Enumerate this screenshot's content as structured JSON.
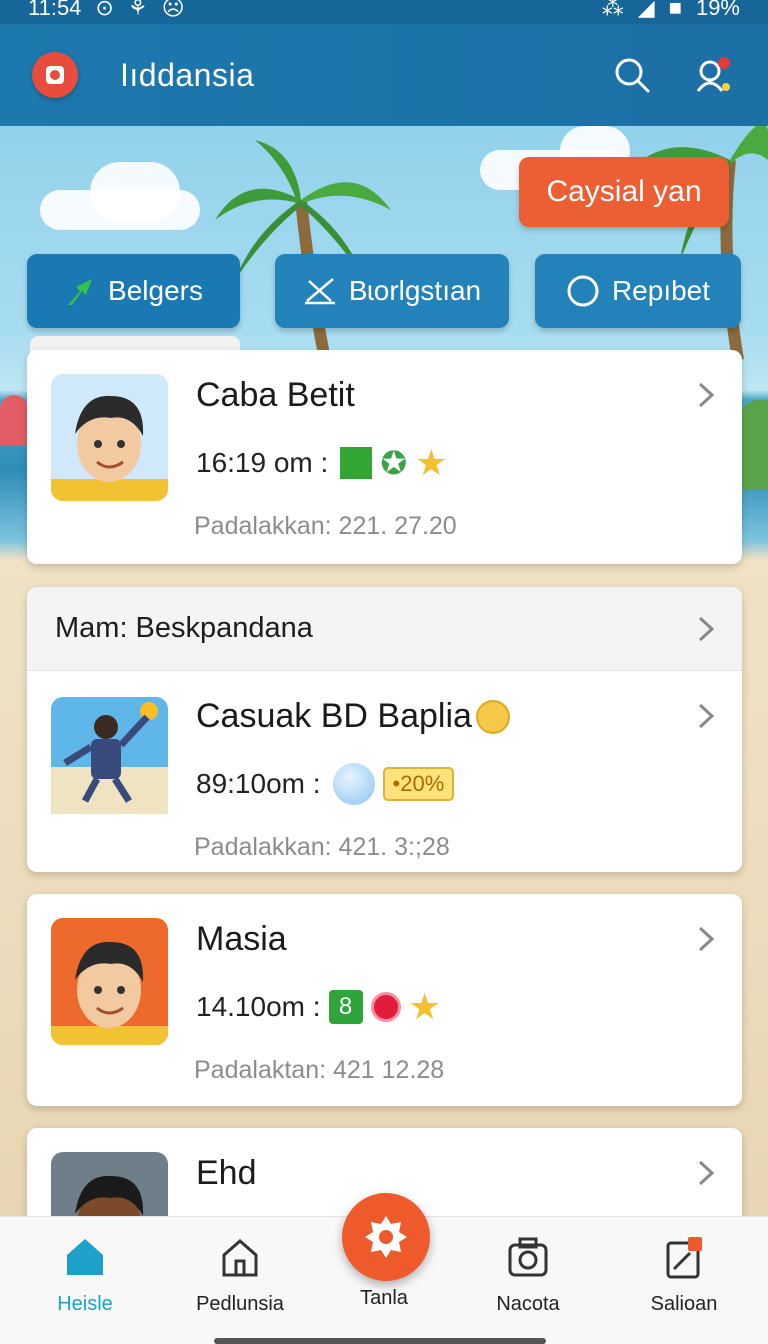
{
  "status_bar": {
    "time": "11:54",
    "battery": "19%"
  },
  "header": {
    "title": "Iıddansia"
  },
  "promo": {
    "label": "Caysial yan"
  },
  "filters": [
    {
      "label": "Belgers"
    },
    {
      "label": "Bɩorlgstıan"
    },
    {
      "label": "Repıbet"
    }
  ],
  "cards": [
    {
      "name": "Caba Betit",
      "time": "16:19 om :",
      "detail": "Padalakkan:  221. 27.20"
    },
    {
      "section": "Mam: Beskpandana",
      "name": "Casuak BD Baplia",
      "time": "89:10om :",
      "badge": "•20%",
      "detail": "Padalakkan:  421. 3:;28"
    },
    {
      "name": "Masia",
      "time": "14.10om :",
      "num_badge": "8",
      "detail": "Padalaktan:  421  12.28"
    },
    {
      "name": "Ehd"
    }
  ],
  "nav": [
    {
      "label": "Heisle",
      "icon": "home-icon"
    },
    {
      "label": "Pedlunsia",
      "icon": "building-icon"
    },
    {
      "label": "Tanla",
      "icon": "gear-icon"
    },
    {
      "label": "Nacota",
      "icon": "camera-icon"
    },
    {
      "label": "Salioan",
      "icon": "document-icon"
    }
  ]
}
